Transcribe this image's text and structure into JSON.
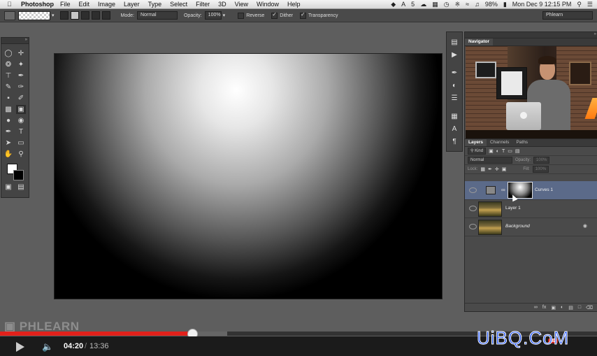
{
  "menubar": {
    "app": "Photoshop",
    "items": [
      "File",
      "Edit",
      "Image",
      "Layer",
      "Type",
      "Select",
      "Filter",
      "3D",
      "View",
      "Window",
      "Help"
    ],
    "status": {
      "ai_badge": "5",
      "battery": "98%",
      "clock": "Mon Dec 9  12:15 PM"
    }
  },
  "options": {
    "mode_label": "Mode:",
    "mode_value": "Normal",
    "opacity_label": "Opacity:",
    "opacity_value": "100%",
    "reverse_label": "Reverse",
    "dither_label": "Dither",
    "transparency_label": "Transparency",
    "workspace": "Phlearn"
  },
  "navigator": {
    "title": "Navigator"
  },
  "layers_panel": {
    "tabs": [
      "Layers",
      "Channels",
      "Paths"
    ],
    "kind_label": "Kind",
    "blend_mode": "Normal",
    "opacity_label": "Opacity:",
    "opacity_value": "100%",
    "lock_label": "Lock:",
    "fill_label": "Fill:",
    "fill_value": "100%",
    "layers": [
      {
        "name": "Curves 1"
      },
      {
        "name": "Layer 1"
      },
      {
        "name": "Background"
      }
    ]
  },
  "watermarks": {
    "phlearn": "PHLEARN",
    "site": "UiBQ.CoM"
  },
  "video": {
    "current_time": "04:20",
    "separator": "/",
    "total_time": "13:36",
    "played_fraction": 0.322,
    "loaded_fraction": 0.38,
    "hd_label": "HD"
  },
  "colors": {
    "progress_red": "#e1211b",
    "selected_layer": "#5b6a89"
  }
}
